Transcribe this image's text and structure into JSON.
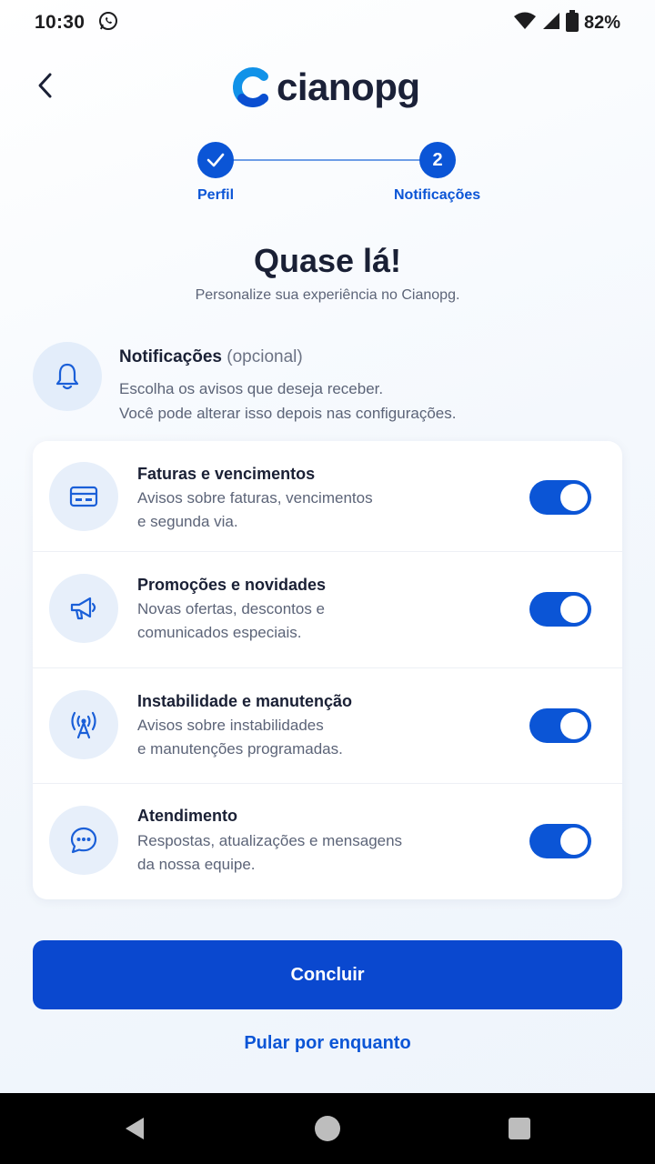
{
  "status_bar": {
    "time": "10:30",
    "battery": "82%"
  },
  "header": {
    "logo_text": "cianopg"
  },
  "stepper": {
    "steps": [
      {
        "label": "Perfil",
        "state": "done"
      },
      {
        "label": "Notificações",
        "number": "2",
        "state": "current"
      }
    ]
  },
  "title": "Quase lá!",
  "subtitle": "Personalize sua experiência no Cianopg.",
  "intro": {
    "title": "Notificações",
    "optional": "(opcional)",
    "desc_line1": "Escolha os avisos que deseja receber.",
    "desc_line2": "Você pode alterar isso depois nas configurações."
  },
  "options": [
    {
      "title": "Faturas e vencimentos",
      "desc1": "Avisos sobre faturas, vencimentos",
      "desc2": "e segunda via.",
      "icon": "card-icon",
      "enabled": true
    },
    {
      "title": "Promoções e novidades",
      "desc1": "Novas ofertas, descontos e",
      "desc2": "comunicados especiais.",
      "icon": "megaphone-icon",
      "enabled": true
    },
    {
      "title": "Instabilidade e manutenção",
      "desc1": "Avisos sobre instabilidades",
      "desc2": "e manutenções programadas.",
      "icon": "antenna-icon",
      "enabled": true
    },
    {
      "title": "Atendimento",
      "desc1": "Respostas, atualizações e mensagens",
      "desc2": "da nossa equipe.",
      "icon": "chat-icon",
      "enabled": true
    }
  ],
  "actions": {
    "primary": "Concluir",
    "skip": "Pular por enquanto"
  },
  "colors": {
    "primary": "#0b55d6",
    "button": "#0a48cf",
    "text": "#1a2035",
    "muted": "#5c6478"
  }
}
